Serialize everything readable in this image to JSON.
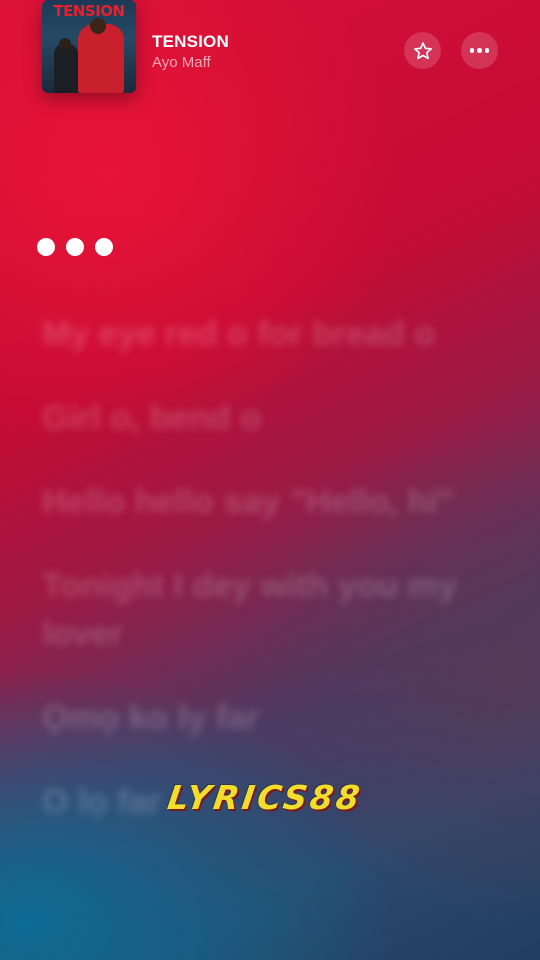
{
  "now_playing": {
    "art_title": "TENSION",
    "title": "TENSION",
    "artist": "Ayo Maff"
  },
  "controls": {
    "favorite_icon": "star-icon",
    "more_icon": "more-horizontal-icon"
  },
  "lyrics": [
    "My eye red o for bread o",
    "Girl o, bend o",
    "Hello hello say \"Hello, hi\"",
    "Tonight I dey with you my lover",
    "Ọmọ ko ly far",
    "O lọ far"
  ],
  "watermark": "LYRICS88",
  "colors": {
    "background_top": "#d81038",
    "background_bottom": "#213e61",
    "accent_teal": "#0a6e96",
    "watermark": "#f1dd2a"
  }
}
